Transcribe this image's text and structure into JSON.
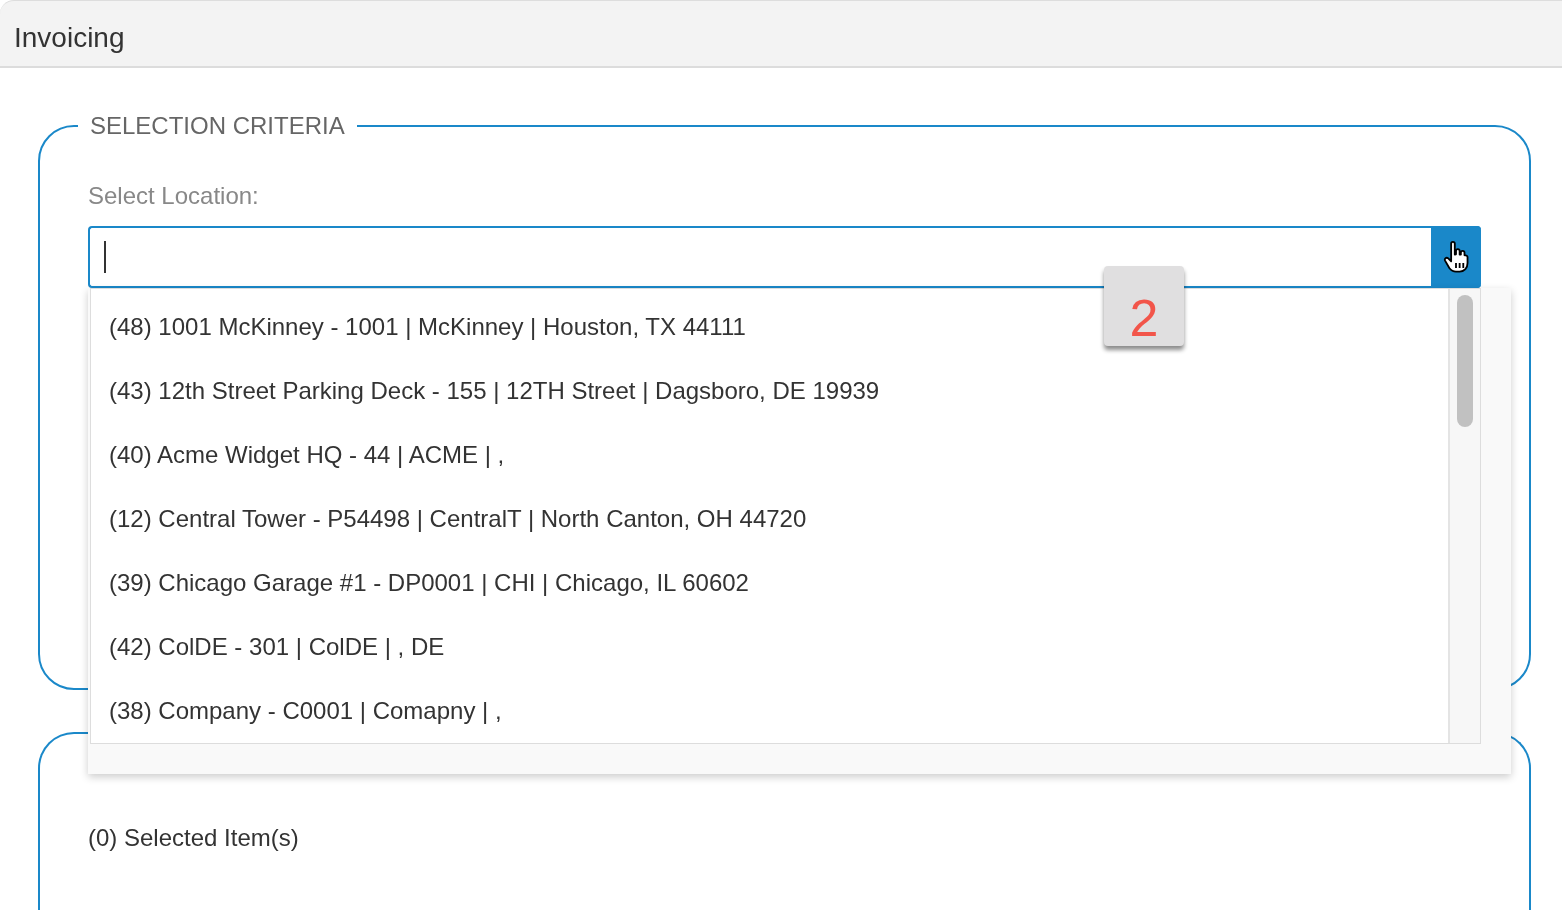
{
  "header": {
    "title": "Invoicing"
  },
  "selection_criteria": {
    "legend": "SELECTION CRITERIA",
    "location_label": "Select Location:",
    "dropdown": {
      "expanded": true,
      "options": [
        {
          "label": "(48) 1001 McKinney - 1001 | McKinney | Houston, TX 44111"
        },
        {
          "label": "(43) 12th Street Parking Deck - 155 | 12TH Street | Dagsboro, DE 19939"
        },
        {
          "label": "(40) Acme Widget HQ - 44 | ACME | ,"
        },
        {
          "label": "(12) Central Tower - P54498 | CentralT | North Canton, OH 44720"
        },
        {
          "label": "(39) Chicago Garage #1 - DP0001 | CHI | Chicago, IL 60602"
        },
        {
          "label": "(42) ColDE - 301 | ColDE | , DE"
        },
        {
          "label": "(38) Company - C0001 | Comapny | ,"
        }
      ]
    }
  },
  "step_badge": "2",
  "selected_panel": {
    "count_text": "(0) Selected Item(s)"
  }
}
